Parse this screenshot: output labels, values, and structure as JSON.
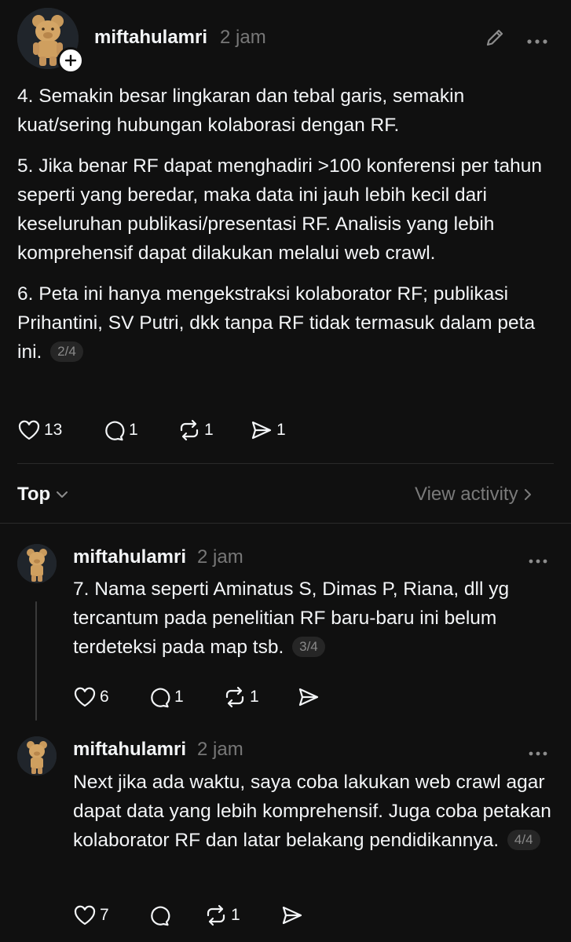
{
  "main_post": {
    "username": "miftahulamri",
    "time": "2 jam",
    "paragraphs": [
      "4. Semakin besar lingkaran dan tebal garis, semakin kuat/sering hubungan kolaborasi dengan RF.",
      "5. Jika benar RF dapat menghadiri >100 konferensi per tahun seperti yang beredar, maka data ini jauh lebih kecil dari keseluruhan publikasi/presentasi RF. Analisis yang lebih komprehensif dapat dilakukan melalui web crawl.",
      "6. Peta ini hanya mengekstraksi kolaborator RF; publikasi Prihantini, SV Putri, dkk tanpa RF tidak termasuk dalam peta ini."
    ],
    "pager": "2/4",
    "likes": "13",
    "replies": "1",
    "reposts": "1",
    "shares": "1"
  },
  "sort_bar": {
    "label": "Top",
    "view_activity": "View activity"
  },
  "replies": [
    {
      "username": "miftahulamri",
      "time": "2 jam",
      "text": "7. Nama seperti Aminatus S, Dimas P, Riana, dll yg tercantum pada penelitian RF baru-baru ini belum terdeteksi pada map tsb.",
      "pager": "3/4",
      "likes": "6",
      "replies": "1",
      "reposts": "1"
    },
    {
      "username": "miftahulamri",
      "time": "2 jam",
      "text": "Next jika ada waktu, saya coba lakukan web crawl agar dapat data yang lebih komprehensif. Juga coba petakan kolaborator RF dan latar belakang pendidikannya.",
      "pager": "4/4",
      "likes": "7",
      "reposts": "1"
    }
  ],
  "colors": {
    "background": "#101010",
    "text": "#f3f5f7",
    "muted": "#777777",
    "pager_bg": "#262626",
    "divider": "#2a2a2a"
  },
  "icons": [
    "edit-pencil-icon",
    "more-icon",
    "heart-icon",
    "comment-icon",
    "repost-icon",
    "share-icon",
    "chevron-down-icon",
    "chevron-right-icon",
    "plus-icon"
  ]
}
